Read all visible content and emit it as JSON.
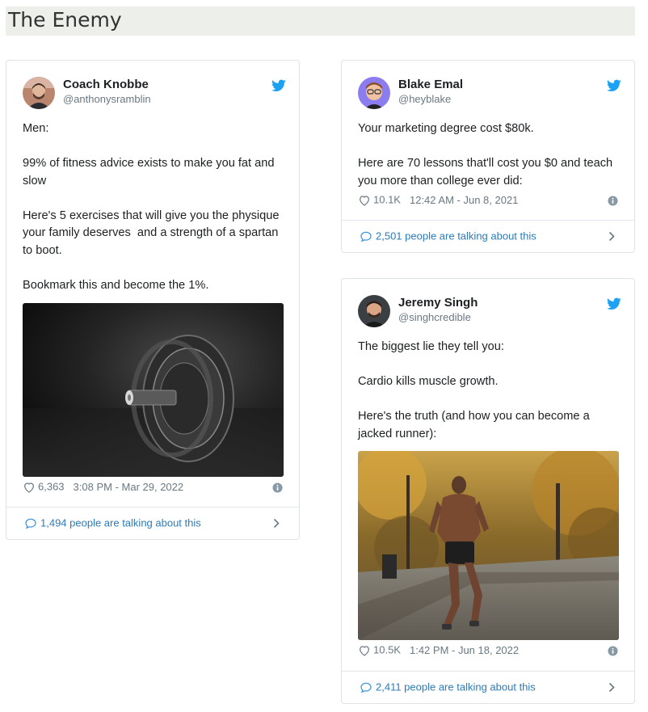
{
  "page": {
    "title": "The Enemy"
  },
  "tweets": [
    {
      "author_name": "Coach Knobbe",
      "handle": "@anthonysramblin",
      "text": "Men:\n\n99% of fitness advice exists to make you fat and slow\n\nHere's 5 exercises that will give you the physique your family deserves  and a strength of a spartan to boot.\n\nBookmark this and become the 1%.",
      "likes": "6,363",
      "timestamp": "3:08 PM - Mar 29, 2022",
      "talking": "1,494 people are talking about this",
      "media": "dumbbell-photo"
    },
    {
      "author_name": "Blake Emal",
      "handle": "@heyblake",
      "text": "Your marketing degree cost $80k.\n\nHere are 70 lessons that'll cost you $0 and teach you more than college ever did:",
      "likes": "10.1K",
      "timestamp": "12:42 AM - Jun 8, 2021",
      "talking": "2,501 people are talking about this"
    },
    {
      "author_name": "Jeremy Singh",
      "handle": "@singhcredible",
      "text": "The biggest lie they tell you:\n\nCardio kills muscle growth.\n\nHere's the truth (and how you can become a jacked runner):",
      "likes": "10.5K",
      "timestamp": "1:42 PM - Jun 18, 2022",
      "talking": "2,411 people are talking about this",
      "media": "runner-photo"
    }
  ],
  "colors": {
    "twitter_blue": "#1da1f2",
    "link_blue": "#2b7bb9",
    "muted": "#697882",
    "header_bg": "#ecefea"
  },
  "icons": [
    "twitter-bird-icon",
    "heart-icon",
    "info-icon",
    "comment-bubble-icon",
    "chevron-right-icon"
  ]
}
